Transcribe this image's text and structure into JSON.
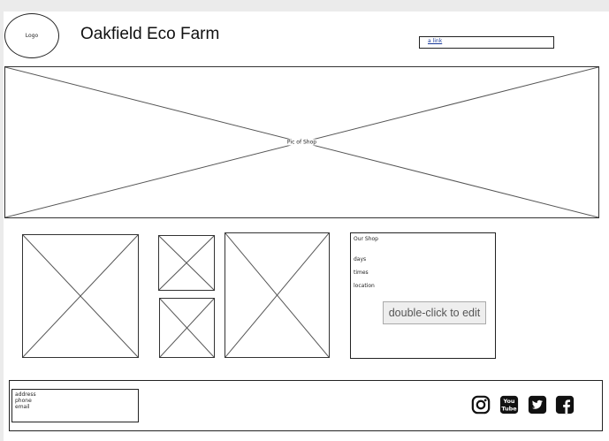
{
  "header": {
    "logo_text": "Logo",
    "site_title": "Oakfield Eco Farm",
    "link_text": "a link"
  },
  "hero": {
    "label": "Pic of Shop"
  },
  "shop_info": {
    "heading": "Our Shop",
    "days": "days",
    "times": "times",
    "location": "location",
    "edit_hint": "double-click to edit"
  },
  "footer": {
    "address": "address",
    "phone": "phone",
    "email": "email",
    "social": [
      {
        "name": "instagram-icon"
      },
      {
        "name": "youtube-icon",
        "text": "You\nTube"
      },
      {
        "name": "twitter-icon"
      },
      {
        "name": "facebook-icon"
      }
    ]
  },
  "colors": {
    "wireframe": "#333333",
    "background": "#ebebeb",
    "link": "#1a3a9a"
  }
}
